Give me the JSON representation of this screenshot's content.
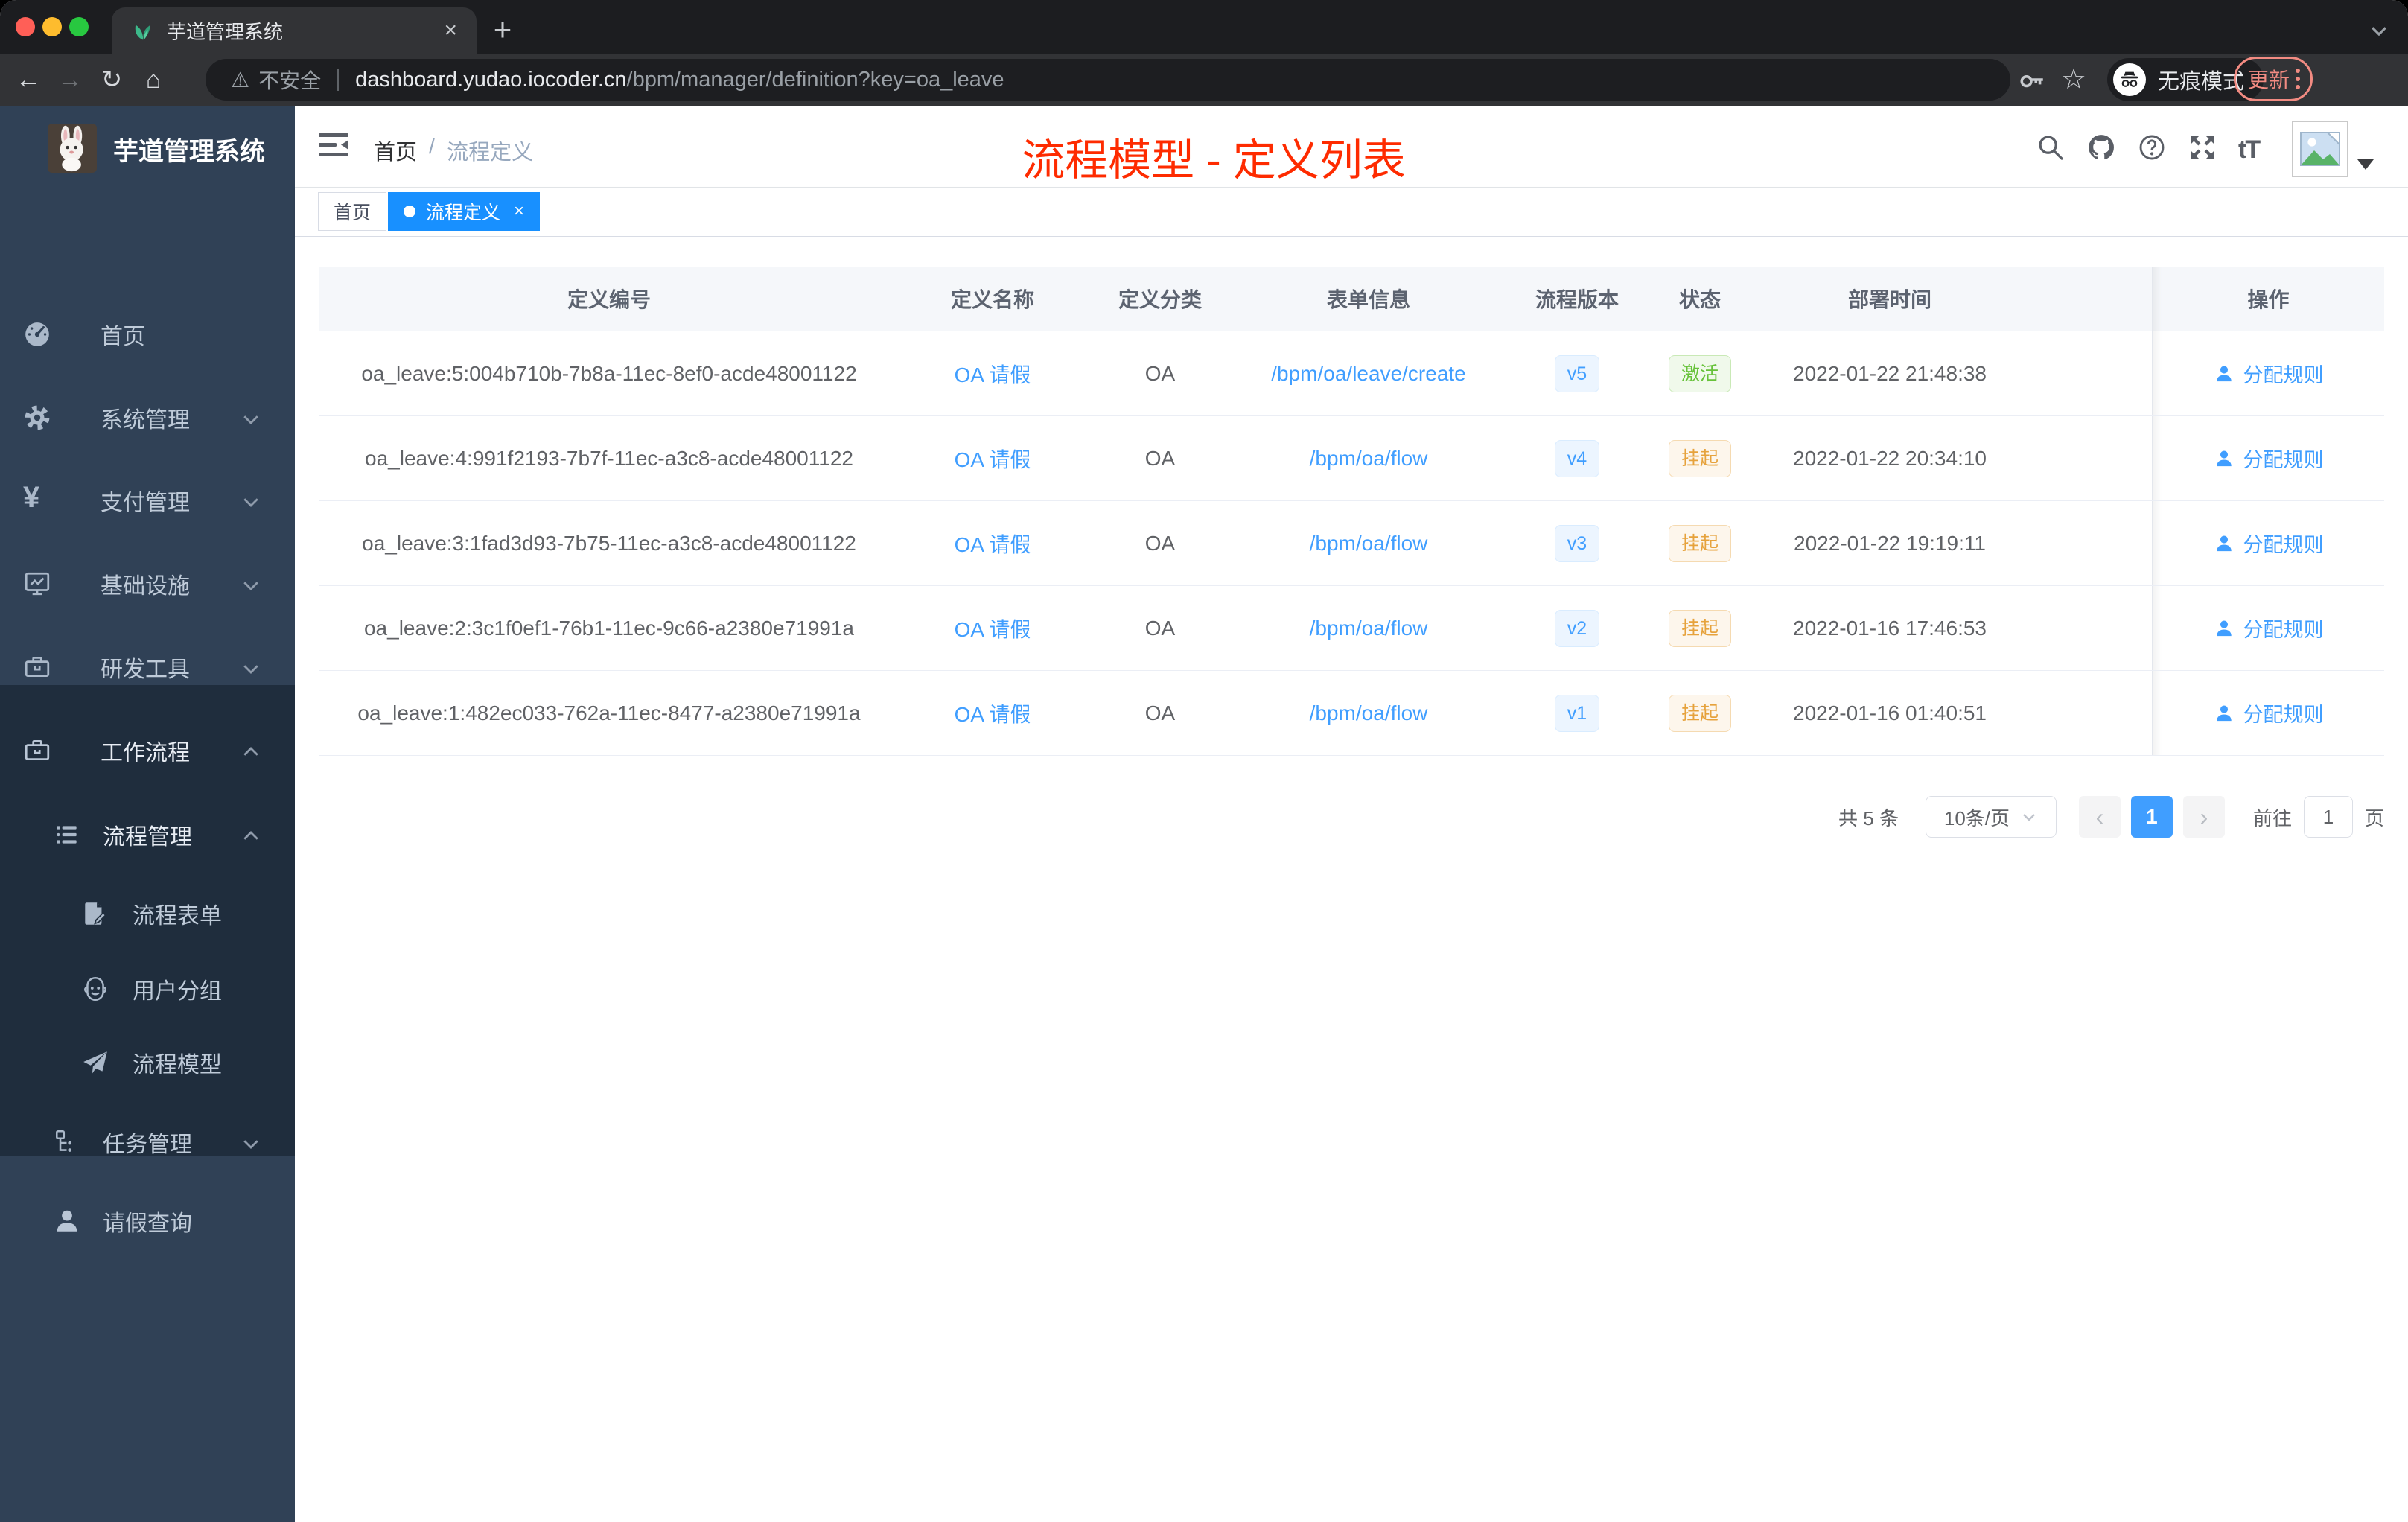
{
  "browser": {
    "tab_title": "芋道管理系统",
    "close_tab": "×",
    "new_tab": "+",
    "back": "←",
    "forward": "→",
    "reload": "↻",
    "home": "⌂",
    "warning": "⚠",
    "security_label": "不安全",
    "url_host": "dashboard.yudao.iocoder.cn",
    "url_path": "/bpm/manager/definition?key=oa_leave",
    "star": "☆",
    "incognito_label": "无痕模式",
    "update_label": "更新"
  },
  "sidebar": {
    "logo_title": "芋道管理系统",
    "items": [
      {
        "label": "首页"
      },
      {
        "label": "系统管理"
      },
      {
        "label": "支付管理"
      },
      {
        "label": "基础设施"
      },
      {
        "label": "研发工具"
      },
      {
        "label": "工作流程"
      },
      {
        "label": "流程管理"
      },
      {
        "label": "流程表单"
      },
      {
        "label": "用户分组"
      },
      {
        "label": "流程模型"
      },
      {
        "label": "任务管理"
      },
      {
        "label": "请假查询"
      }
    ]
  },
  "navbar": {
    "breadcrumb": [
      "首页",
      "流程定义"
    ],
    "breadcrumb_sep": "/",
    "annotation": "流程模型 - 定义列表",
    "font_size_icon": "tT"
  },
  "tags": [
    {
      "label": "首页"
    },
    {
      "label": "流程定义",
      "close": "×"
    }
  ],
  "table": {
    "headers": [
      "定义编号",
      "定义名称",
      "定义分类",
      "表单信息",
      "流程版本",
      "状态",
      "部署时间",
      "操作"
    ],
    "rows": [
      {
        "id": "oa_leave:5:004b710b-7b8a-11ec-8ef0-acde48001122",
        "name": "OA 请假",
        "category": "OA",
        "form": "/bpm/oa/leave/create",
        "version": "v5",
        "status": "激活",
        "time": "2022-01-22 21:48:38",
        "action": "分配规则"
      },
      {
        "id": "oa_leave:4:991f2193-7b7f-11ec-a3c8-acde48001122",
        "name": "OA 请假",
        "category": "OA",
        "form": "/bpm/oa/flow",
        "version": "v4",
        "status": "挂起",
        "time": "2022-01-22 20:34:10",
        "action": "分配规则"
      },
      {
        "id": "oa_leave:3:1fad3d93-7b75-11ec-a3c8-acde48001122",
        "name": "OA 请假",
        "category": "OA",
        "form": "/bpm/oa/flow",
        "version": "v3",
        "status": "挂起",
        "time": "2022-01-22 19:19:11",
        "action": "分配规则"
      },
      {
        "id": "oa_leave:2:3c1f0ef1-76b1-11ec-9c66-a2380e71991a",
        "name": "OA 请假",
        "category": "OA",
        "form": "/bpm/oa/flow",
        "version": "v2",
        "status": "挂起",
        "time": "2022-01-16 17:46:53",
        "action": "分配规则"
      },
      {
        "id": "oa_leave:1:482ec033-762a-11ec-8477-a2380e71991a",
        "name": "OA 请假",
        "category": "OA",
        "form": "/bpm/oa/flow",
        "version": "v1",
        "status": "挂起",
        "time": "2022-01-16 01:40:51",
        "action": "分配规则"
      }
    ]
  },
  "pagination": {
    "total": "共 5 条",
    "page_size": "10条/页",
    "prev": "‹",
    "current": "1",
    "next": "›",
    "goto_label": "前往",
    "goto_value": "1",
    "page_unit": "页"
  },
  "colors": {
    "accent_blue": "#409eff",
    "tag_active_blue": "#1890ff",
    "annotation_red": "#fe2b00",
    "status_active_green": "#67c23a",
    "status_suspended_orange": "#e6a23c",
    "sidebar_bg": "#304156",
    "submenu_bg": "#1f2d3d"
  }
}
